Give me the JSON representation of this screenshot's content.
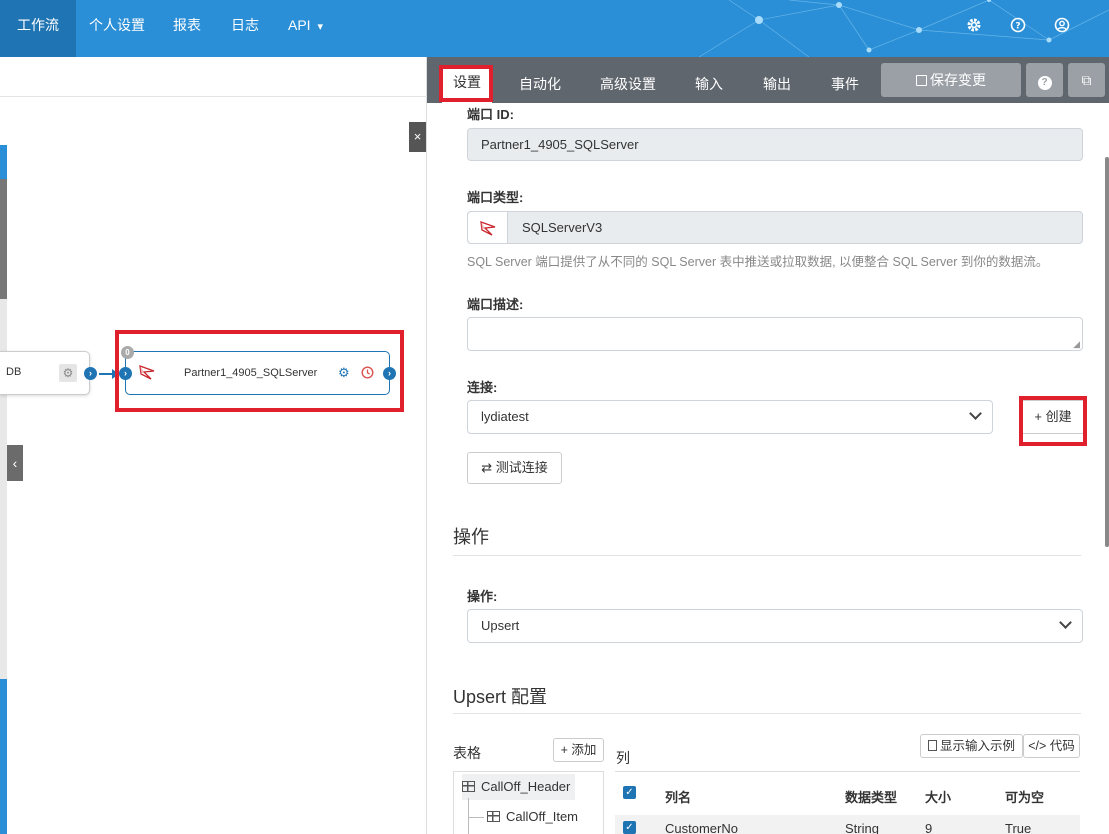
{
  "nav": {
    "items": [
      "工作流",
      "个人设置",
      "报表",
      "日志",
      "API"
    ],
    "api_caret": "▾",
    "icons": [
      "gear-icon",
      "help-icon",
      "user-icon"
    ]
  },
  "canvas": {
    "prev_node_label": "DB",
    "main_node_label": "Partner1_4905_SQLServer",
    "main_node_badge": "0",
    "close_label": "×",
    "collapse_label": "‹"
  },
  "tabs": [
    "设置",
    "自动化",
    "高级设置",
    "输入",
    "输出",
    "事件"
  ],
  "toolbar": {
    "save_label": "保存变更",
    "help_label": "?",
    "external_label": "⧉"
  },
  "form": {
    "port_id_label": "端口 ID:",
    "port_id_value": "Partner1_4905_SQLServer",
    "port_type_label": "端口类型:",
    "port_type_value": "SQLServerV3",
    "port_type_hint": "SQL Server 端口提供了从不同的 SQL Server 表中推送或拉取数据, 以便整合 SQL Server 到你的数据流。",
    "port_desc_label": "端口描述:",
    "port_desc_value": "",
    "connection_label": "连接:",
    "connection_value": "lydiatest",
    "create_label": "+ 创建",
    "test_label": "⇄ 测试连接"
  },
  "operation": {
    "section_title": "操作",
    "label": "操作:",
    "value": "Upsert"
  },
  "upsert": {
    "section_title": "Upsert 配置",
    "tables_label": "表格",
    "add_label": "+ 添加",
    "columns_label": "列",
    "show_sample_label": "显示输入示例",
    "code_label": "</> 代码",
    "tables": [
      "CallOff_Header",
      "CallOff_Item"
    ],
    "headers": [
      "列名",
      "数据类型",
      "大小",
      "可为空"
    ],
    "rows": [
      {
        "name": "CustomerNo",
        "type": "String",
        "size": "9",
        "nullable": "True"
      }
    ]
  },
  "colors": {
    "nav_bg": "#2a8fd6",
    "nav_active": "#1f74b3",
    "tabbar_bg": "#5f666d",
    "highlight_red": "#e0202c"
  }
}
